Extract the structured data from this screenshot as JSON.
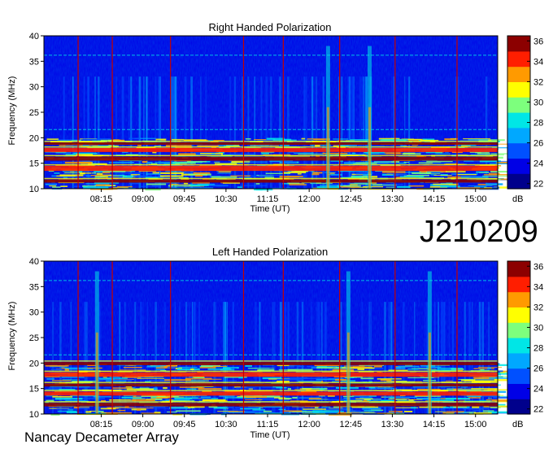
{
  "id_label": "J210209",
  "credit": "Nancay Decameter Array",
  "colors": {
    "colormap": [
      "#00008c",
      "#0000e6",
      "#0050ff",
      "#00a8ff",
      "#00e6e6",
      "#7dff7d",
      "#ffff00",
      "#ff9a00",
      "#ff1e00",
      "#8c0000"
    ]
  },
  "chart_data": [
    {
      "type": "heatmap",
      "title": "Right Handed Polarization",
      "xlabel": "Time (UT)",
      "ylabel": "Frequency (MHz)",
      "xticks": [
        "08:15",
        "09:00",
        "09:45",
        "10:30",
        "11:15",
        "12:00",
        "12:45",
        "13:30",
        "14:15",
        "15:00"
      ],
      "yticks": [
        10,
        15,
        20,
        25,
        30,
        35,
        40
      ],
      "ylim": [
        10,
        40
      ],
      "colorbar": {
        "label": "dB",
        "ticks": [
          22,
          24,
          26,
          28,
          30,
          32,
          34,
          36
        ],
        "range": [
          21.5,
          36.5
        ]
      },
      "vertical_markers": [
        "07:50",
        "08:27",
        "09:30",
        "10:49",
        "11:32",
        "12:33",
        "13:33",
        "14:40"
      ],
      "emission_bands_mhz": [
        [
          11.2,
          11.8
        ],
        [
          13.5,
          14.5
        ],
        [
          15.5,
          16.3
        ],
        [
          17.2,
          18.0
        ],
        [
          18.6,
          19.1
        ]
      ],
      "bursts_ut": [
        "12:20",
        "13:05"
      ]
    },
    {
      "type": "heatmap",
      "title": "Left Handed Polarization",
      "xlabel": "Time (UT)",
      "ylabel": "Frequency (MHz)",
      "xticks": [
        "08:15",
        "09:00",
        "09:45",
        "10:30",
        "11:15",
        "12:00",
        "12:45",
        "13:30",
        "14:15",
        "15:00"
      ],
      "yticks": [
        10,
        15,
        20,
        25,
        30,
        35,
        40
      ],
      "ylim": [
        10,
        40
      ],
      "colorbar": {
        "label": "dB",
        "ticks": [
          22,
          24,
          26,
          28,
          30,
          32,
          34,
          36
        ],
        "range": [
          21.5,
          36.5
        ]
      },
      "vertical_markers": [
        "07:50",
        "08:27",
        "09:30",
        "10:49",
        "11:32",
        "12:33",
        "13:33",
        "14:40"
      ],
      "emission_bands_mhz": [
        [
          11.5,
          12.2
        ],
        [
          13.6,
          14.4
        ],
        [
          15.4,
          16.0
        ],
        [
          17.3,
          18.2
        ],
        [
          19.6,
          20.2
        ]
      ],
      "bursts_ut": [
        "08:10",
        "12:42",
        "14:10"
      ]
    }
  ]
}
